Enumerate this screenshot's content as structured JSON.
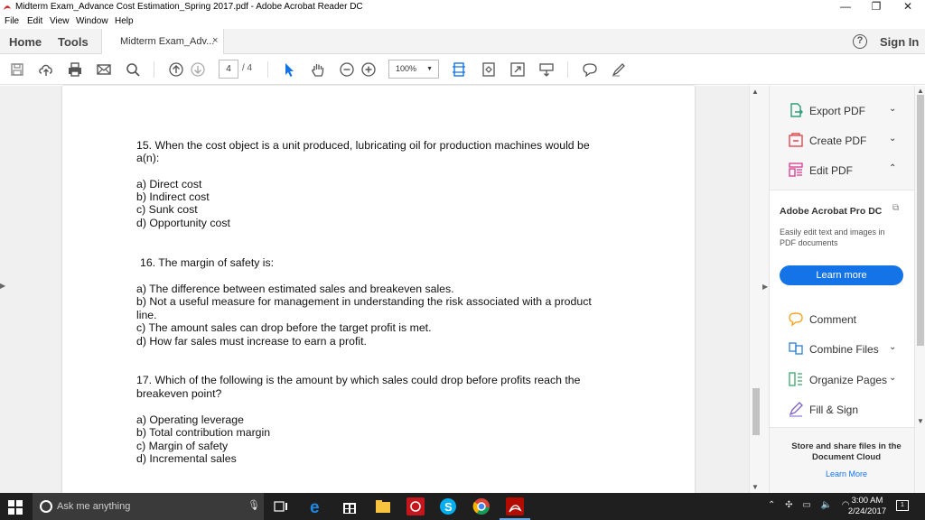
{
  "window": {
    "title": "Midterm Exam_Advance Cost Estimation_Spring 2017.pdf - Adobe Acrobat Reader DC",
    "minimize": "—",
    "maximize": "❐",
    "close": "✕"
  },
  "menu": [
    "File",
    "Edit",
    "View",
    "Window",
    "Help"
  ],
  "tabs": {
    "home": "Home",
    "tools": "Tools",
    "document": "Midterm Exam_Adv...",
    "document_close": "×",
    "help": "?",
    "signin": "Sign In"
  },
  "toolbar": {
    "page_current": "4",
    "page_total": "/ 4",
    "zoom": "100%"
  },
  "document": {
    "lines": [
      "15. When the cost object is a unit produced, lubricating oil for production machines would be",
      "a(n):",
      "a) Direct cost",
      "b) Indirect cost",
      "c) Sunk cost",
      "d) Opportunity cost",
      "16. The margin of safety is:",
      "a) The difference between estimated sales and breakeven sales.",
      "b) Not a useful measure for management in understanding the risk associated with a product",
      "line.",
      "c) The amount sales can drop before the target profit is met.",
      "d) How far sales must increase to earn a profit.",
      "17. Which of the following is the amount by which sales could drop before profits reach the",
      "breakeven point?",
      "a) Operating leverage",
      "b) Total contribution margin",
      "c) Margin of safety",
      "d) Incremental sales"
    ]
  },
  "right_pane": {
    "tools": [
      {
        "label": "Export PDF",
        "chevron": "⌄"
      },
      {
        "label": "Create PDF",
        "chevron": "⌄"
      },
      {
        "label": "Edit PDF",
        "chevron": "⌃"
      }
    ],
    "promo_title": "Adobe Acrobat Pro DC",
    "promo_desc": "Easily edit text and images in PDF documents",
    "promo_button": "Learn more",
    "tools2": [
      {
        "label": "Comment",
        "chevron": ""
      },
      {
        "label": "Combine Files",
        "chevron": "⌄"
      },
      {
        "label": "Organize Pages",
        "chevron": "⌄"
      },
      {
        "label": "Fill & Sign",
        "chevron": ""
      }
    ],
    "cloud_text": "Store and share files in the Document Cloud",
    "cloud_link": "Learn More"
  },
  "taskbar": {
    "search_placeholder": "Ask me anything",
    "time": "3:00 AM",
    "date": "2/24/2017",
    "notifications": "1"
  },
  "colors": {
    "accent": "#1473e6",
    "export_pdf": "#2d9d78",
    "create_pdf": "#e34850",
    "edit_pdf": "#d83790",
    "comment": "#f5a623",
    "combine": "#2c7fcf",
    "organize": "#3aa76d",
    "fillsign": "#7b5ec7"
  }
}
